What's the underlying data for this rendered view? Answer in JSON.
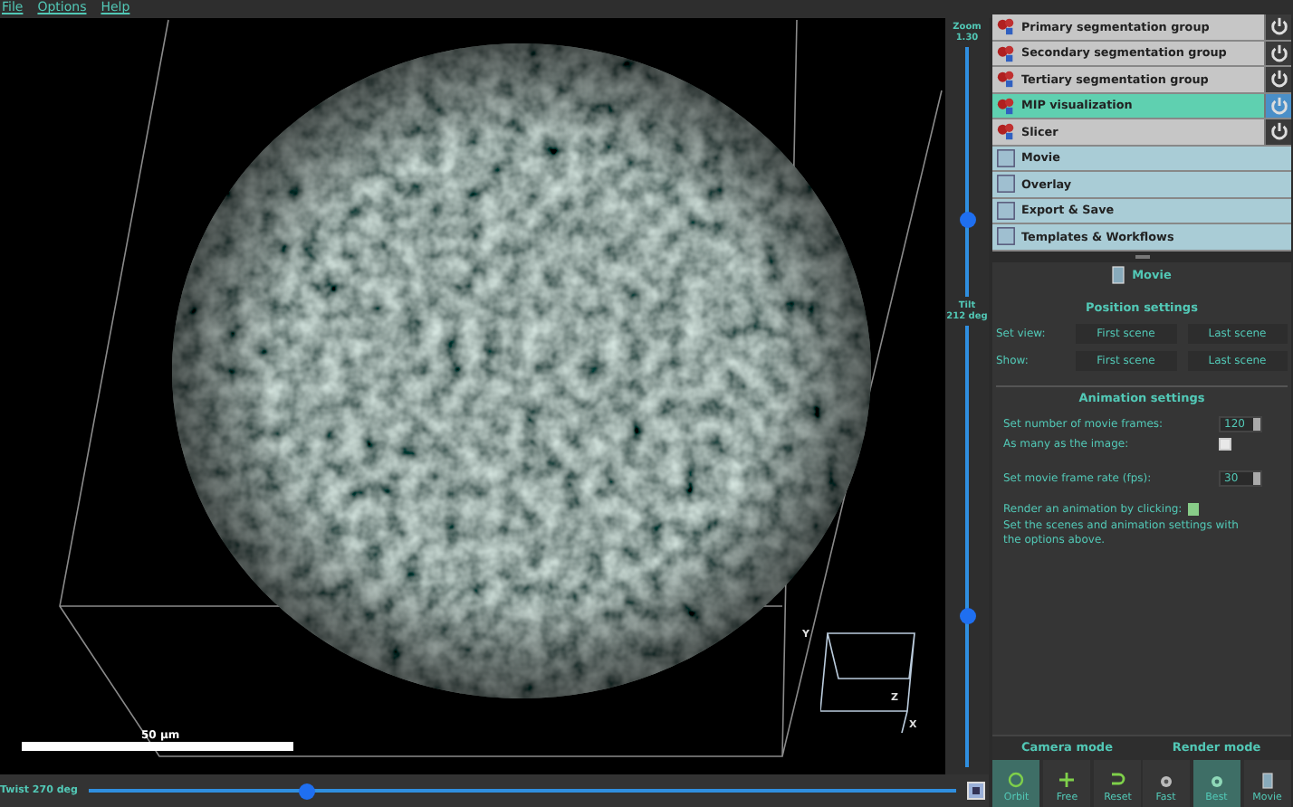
{
  "menu": [
    "File",
    "Options",
    "Help"
  ],
  "zoom": {
    "label": "Zoom",
    "value": "1.30",
    "level": 0.3
  },
  "tilt": {
    "label": "Tilt",
    "value": "212 deg",
    "level": 0.34
  },
  "twist": {
    "label": "Twist 270 deg",
    "level": 0.25
  },
  "scale_bar": {
    "label": "50 µm"
  },
  "axes": [
    "Y",
    "Z",
    "X"
  ],
  "groups": [
    {
      "kind": "module",
      "label": "Primary segmentation group",
      "selected": false,
      "on": false
    },
    {
      "kind": "module",
      "label": "Secondary segmentation group",
      "selected": false,
      "on": false
    },
    {
      "kind": "module",
      "label": "Tertiary segmentation group",
      "selected": false,
      "on": false
    },
    {
      "kind": "module",
      "label": "MIP visualization",
      "selected": true,
      "on": true
    },
    {
      "kind": "module",
      "label": "Slicer",
      "selected": false,
      "on": false
    },
    {
      "kind": "tool",
      "label": "Movie",
      "selected": false
    },
    {
      "kind": "tool",
      "label": "Overlay",
      "selected": false
    },
    {
      "kind": "tool",
      "label": "Export & Save",
      "selected": false
    },
    {
      "kind": "tool",
      "label": "Templates & Workflows",
      "selected": false
    }
  ],
  "panel": {
    "title": "Movie",
    "position_heading": "Position settings",
    "position_rows": [
      {
        "label": "Set view:",
        "buttons": [
          "First scene",
          "Last scene"
        ]
      },
      {
        "label": "Show:",
        "buttons": [
          "First scene",
          "Last scene"
        ]
      }
    ],
    "animation_heading": "Animation settings",
    "frames": {
      "label": "Set number of movie frames:",
      "value": "120"
    },
    "as_many": {
      "label": "As many as the image:",
      "checked": false
    },
    "fps": {
      "label": "Set movie frame rate (fps):",
      "value": "30"
    },
    "render": {
      "label": "Render an animation by clicking:"
    },
    "hint": "Set the scenes and animation settings with the options above."
  },
  "camera_mode": {
    "title": "Camera mode",
    "buttons": [
      {
        "kind": "orbit",
        "label": "Orbit",
        "selected": true
      },
      {
        "kind": "free",
        "label": "Free",
        "selected": false
      },
      {
        "kind": "reset",
        "label": "Reset",
        "selected": false
      }
    ]
  },
  "render_mode": {
    "title": "Render mode",
    "buttons": [
      {
        "kind": "fast",
        "label": "Fast",
        "selected": false
      },
      {
        "kind": "best",
        "label": "Best",
        "selected": true
      },
      {
        "kind": "movie",
        "label": "Movie",
        "selected": false
      }
    ]
  }
}
